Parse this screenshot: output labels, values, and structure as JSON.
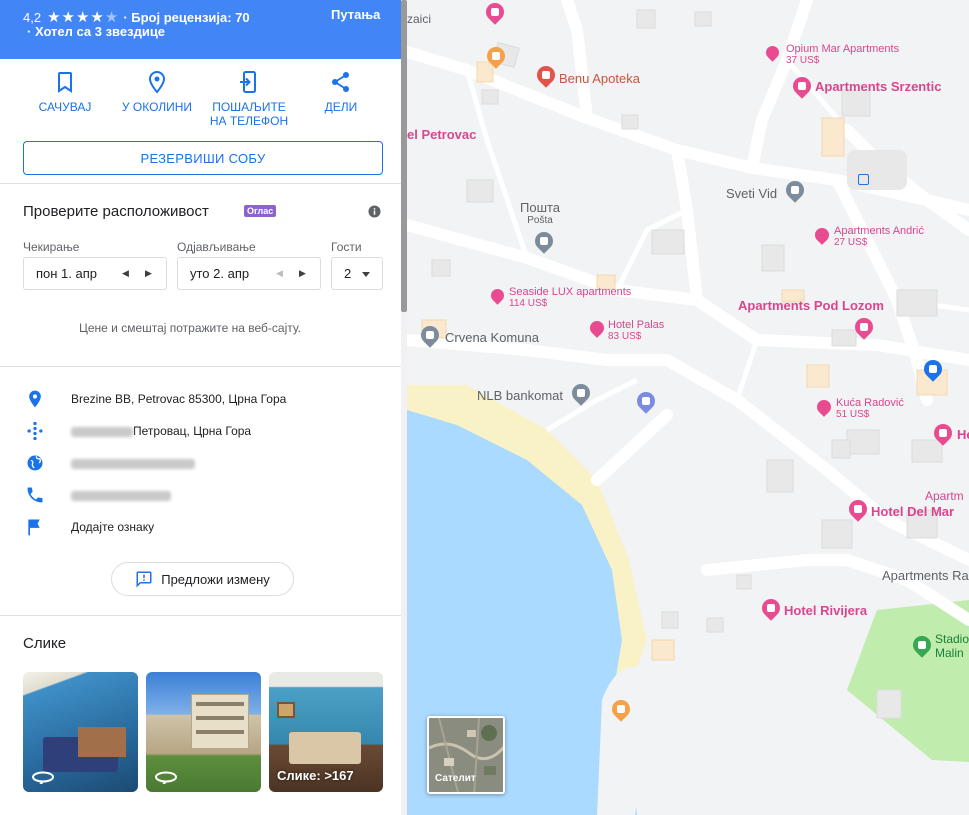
{
  "header": {
    "rating": "4,2",
    "rating_value": 4.2,
    "review_text": "· Број рецензија: 70",
    "hotel_class": "· Хотел са 3 звездице",
    "route_label": "Путања",
    "background_color": "#4285f4"
  },
  "actions": [
    {
      "label": "САЧУВАЈ",
      "icon": "bookmark-icon"
    },
    {
      "label": "У ОКОЛИНИ",
      "icon": "nearby-icon"
    },
    {
      "label": "ПОШАЉИТЕ НА ТЕЛЕФОН",
      "icon": "send-to-phone-icon"
    },
    {
      "label": "ДЕЛИ",
      "icon": "share-icon"
    }
  ],
  "book_room_label": "РЕЗЕРВИШИ СОБУ",
  "availability": {
    "title": "Проверите расположивост",
    "ad_badge": "Оглас",
    "checkin_label": "Чекирање",
    "checkin_value": "пон 1. апр",
    "checkout_label": "Одјављивање",
    "checkout_value": "уто 2. апр",
    "guests_label": "Гости",
    "guests_value": "2",
    "note": "Цене и смештај потражите на веб-сајту."
  },
  "info": {
    "address": "Brezine BB, Petrovac 85300, Црна Гора",
    "plus_code_suffix": "Петровац, Црна Гора",
    "add_label": "Додајте ознаку"
  },
  "suggest_edit_label": "Предложи измену",
  "photos": {
    "title": "Слике",
    "more_label": "Слике: >167"
  },
  "map": {
    "satellite_label": "Сателит",
    "colors": {
      "land": "#f1f3f4",
      "water": "#aadaff",
      "beach": "#faf2c7",
      "park": "#c0ecae",
      "road": "#ffffff",
      "hotel_pin": "#e94b90"
    },
    "places": [
      {
        "name": "zaici",
        "type": "grey"
      },
      {
        "name": "Opium Mar Apartments",
        "price": "37 US$",
        "type": "pink"
      },
      {
        "name": "Benu Apoteka",
        "type": "orange"
      },
      {
        "name": "Apartments Srzentic",
        "type": "pink"
      },
      {
        "name": "el Petrovac",
        "type": "pink"
      },
      {
        "name": "Sveti Vid",
        "type": "grey"
      },
      {
        "name": "Пошта",
        "sub": "Pošta",
        "type": "grey"
      },
      {
        "name": "Apartments Andrić",
        "price": "27 US$",
        "type": "pink"
      },
      {
        "name": "Seaside LUX apartments",
        "price": "114 US$",
        "type": "pink"
      },
      {
        "name": "Apartments Pod Lozom",
        "type": "pink"
      },
      {
        "name": "Hotel Palas",
        "price": "83 US$",
        "type": "pink"
      },
      {
        "name": "Crvena Komuna",
        "type": "grey"
      },
      {
        "name": "NLB bankomat",
        "type": "grey"
      },
      {
        "name": "Kuća Radović",
        "price": "51 US$",
        "type": "pink"
      },
      {
        "name": "He",
        "type": "pink"
      },
      {
        "name": "Apartm",
        "type": "pink"
      },
      {
        "name": "Hotel Del Mar",
        "type": "pink"
      },
      {
        "name": "Apartments Ra",
        "type": "grey"
      },
      {
        "name": "Hotel Rivijera",
        "type": "pink"
      },
      {
        "name": "Stadio",
        "sub": "Malin",
        "type": "green"
      }
    ]
  }
}
